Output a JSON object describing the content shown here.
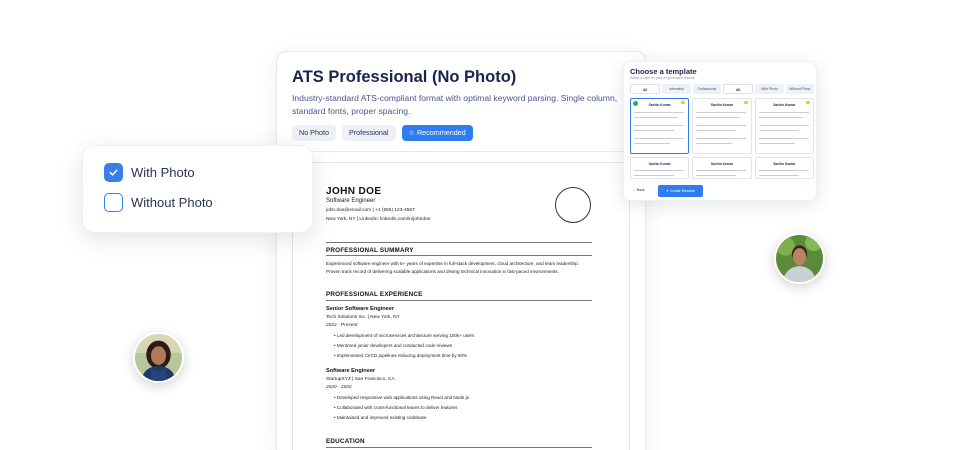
{
  "template_card": {
    "title": "ATS Professional (No Photo)",
    "description": "Industry-standard ATS-compliant format with optimal keyword parsing. Single column, standard fonts, proper spacing.",
    "tags": [
      "No Photo",
      "Professional",
      "Recommended"
    ],
    "recommended_icon": "star-icon"
  },
  "resume": {
    "name": "JOHN DOE",
    "role": "Software Engineer",
    "contact": "john.doe@email.com | +1 (555) 123-4567",
    "location": "New York, NY | LinkedIn: linkedin.com/in/johndoe",
    "summary_heading": "PROFESSIONAL SUMMARY",
    "summary": "Experienced software engineer with 5+ years of expertise in full-stack development, cloud architecture, and team leadership. Proven track record of delivering scalable applications and driving technical innovation in fast-paced environments.",
    "experience_heading": "PROFESSIONAL EXPERIENCE",
    "jobs": [
      {
        "title": "Senior Software Engineer",
        "company": "Tech Solutions Inc. | New York, NY",
        "dates": "2022 - Present",
        "bullets": [
          "• Led development of microservices architecture serving 100k+ users",
          "• Mentored junior developers and conducted code reviews",
          "• Implemented CI/CD pipelines reducing deployment time by 60%"
        ]
      },
      {
        "title": "Software Engineer",
        "company": "StartupXYZ | San Francisco, CA",
        "dates": "2020 - 2022",
        "bullets": [
          "• Developed responsive web applications using React and Node.js",
          "• Collaborated with cross-functional teams to deliver features",
          "• Maintained and improved existing codebase"
        ]
      }
    ],
    "education_heading": "EDUCATION"
  },
  "photo_filter": {
    "options": [
      {
        "label": "With Photo",
        "checked": true
      },
      {
        "label": "Without Photo",
        "checked": false
      }
    ],
    "accent": "#3b7ee8"
  },
  "choose_panel": {
    "title": "Choose a template",
    "subtitle": "Select a style for your AI generated resume",
    "tabs": [
      "All",
      "Internship",
      "Professional",
      "All",
      "With Photo",
      "Without Photo"
    ],
    "thumb_name": "Sachin Kumar",
    "back_label": "← Back",
    "create_label": "Create Resume"
  },
  "colors": {
    "title": "#1a2350",
    "accent": "#2f7cf0"
  }
}
